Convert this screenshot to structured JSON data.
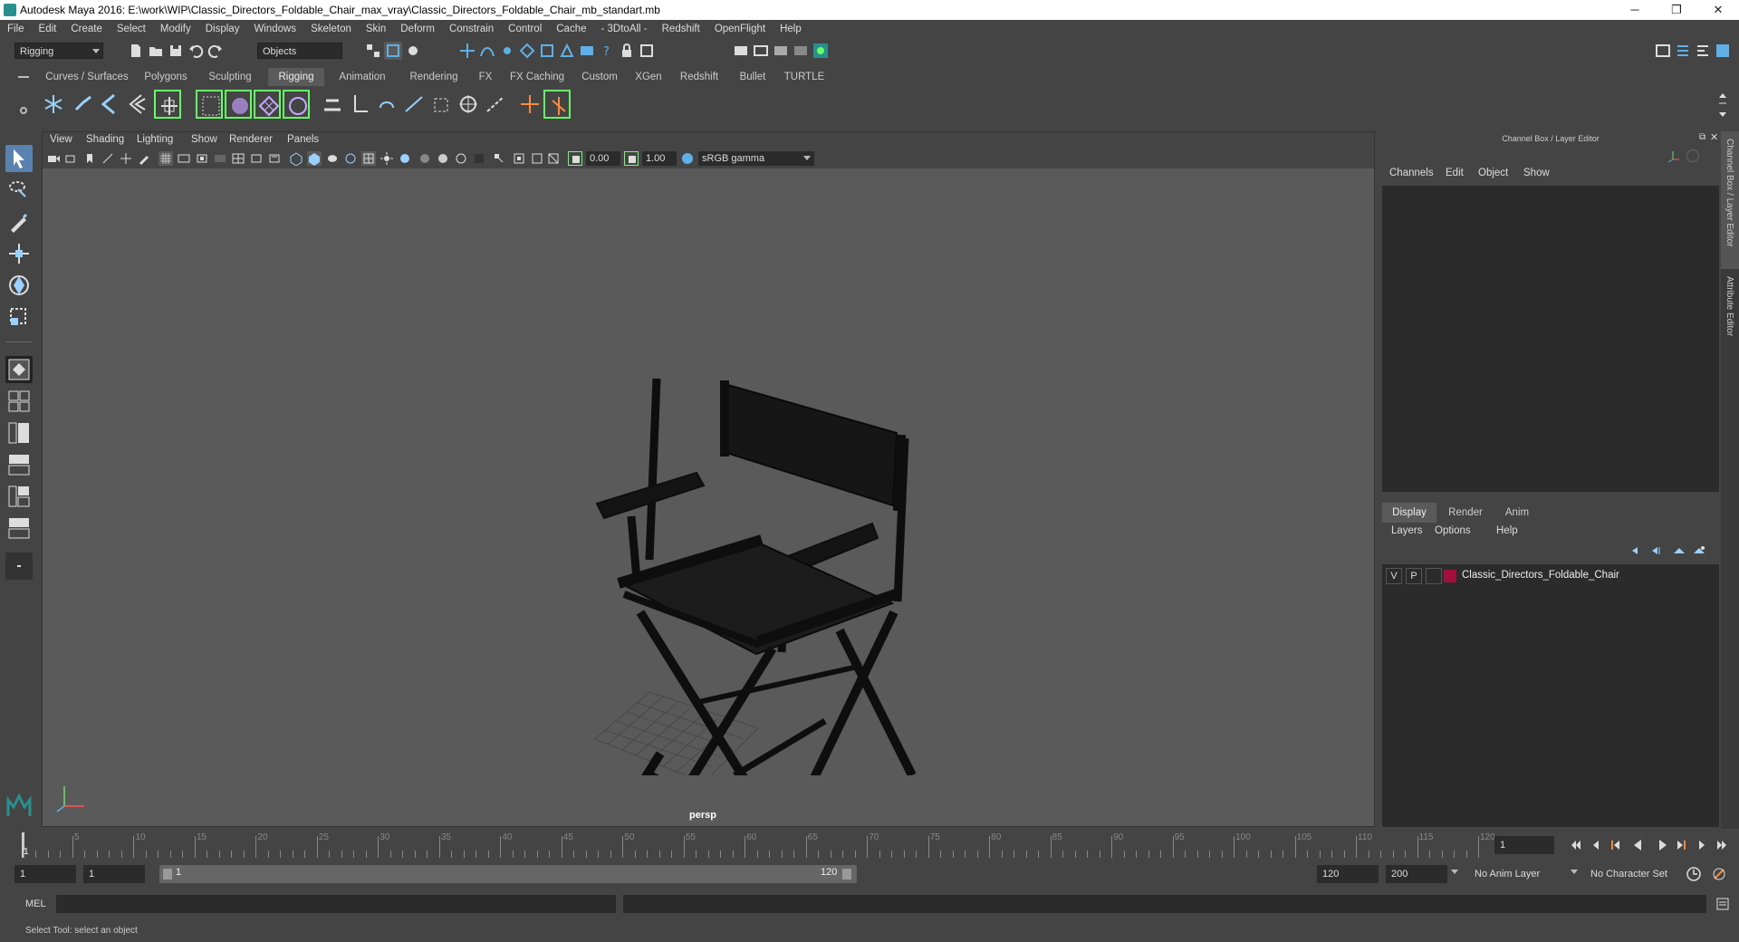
{
  "window": {
    "title": "Autodesk Maya 2016: E:\\work\\WIP\\Classic_Directors_Foldable_Chair_max_vray\\Classic_Directors_Foldable_Chair_mb_standart.mb",
    "minimize": "─",
    "restore": "❐",
    "close": "✕"
  },
  "menubar": [
    "File",
    "Edit",
    "Create",
    "Select",
    "Modify",
    "Display",
    "Windows",
    "Skeleton",
    "Skin",
    "Deform",
    "Constrain",
    "Control",
    "Cache",
    "- 3DtoAll -",
    "Redshift",
    "OpenFlight",
    "Help"
  ],
  "statusline": {
    "mode": "Rigging",
    "selection_mode": "Objects"
  },
  "shelf": {
    "tabs": [
      "Curves / Surfaces",
      "Polygons",
      "Sculpting",
      "Rigging",
      "Animation",
      "Rendering",
      "FX",
      "FX Caching",
      "Custom",
      "XGen",
      "Redshift",
      "Bullet",
      "TURTLE"
    ],
    "active_tab": "Rigging"
  },
  "viewport": {
    "menu": [
      "View",
      "Shading",
      "Lighting",
      "Show",
      "Renderer",
      "Panels"
    ],
    "exposure": "0.00",
    "gamma": "1.00",
    "color_space": "sRGB gamma",
    "camera": "persp"
  },
  "channel_box": {
    "header": "Channel Box / Layer Editor",
    "menu": [
      "Channels",
      "Edit",
      "Object",
      "Show"
    ]
  },
  "layer_editor": {
    "tabs": [
      "Display",
      "Render",
      "Anim"
    ],
    "active_tab": "Display",
    "menu": [
      "Layers",
      "Options",
      "Help"
    ],
    "layers": [
      {
        "v": "V",
        "p": "P",
        "name": "Classic_Directors_Foldable_Chair",
        "color": "#a0103a"
      }
    ]
  },
  "side_tabs": {
    "channel_box": "Channel Box / Layer Editor",
    "attribute_editor": "Attribute Editor"
  },
  "timeline": {
    "ticks": [
      "5",
      "10",
      "15",
      "20",
      "25",
      "30",
      "35",
      "40",
      "45",
      "50",
      "55",
      "60",
      "65",
      "70",
      "75",
      "80",
      "85",
      "90",
      "95",
      "100",
      "105",
      "110",
      "115",
      "120"
    ],
    "start_label": "1",
    "current_frame": "1"
  },
  "range": {
    "start": "1",
    "playback_start": "1",
    "slider_start": "1",
    "slider_end": "120",
    "playback_end": "120",
    "end": "200",
    "anim_layer": "No Anim Layer",
    "character_set": "No Character Set"
  },
  "mel": {
    "label": "MEL"
  },
  "help_line": "Select Tool: select an object",
  "colors": {
    "accent": "#5a5a5a",
    "icon_blue": "#5fb0e8",
    "icon_green": "#66ff66",
    "layer_red": "#a0103a",
    "maya_teal": "#2a8f8f"
  }
}
